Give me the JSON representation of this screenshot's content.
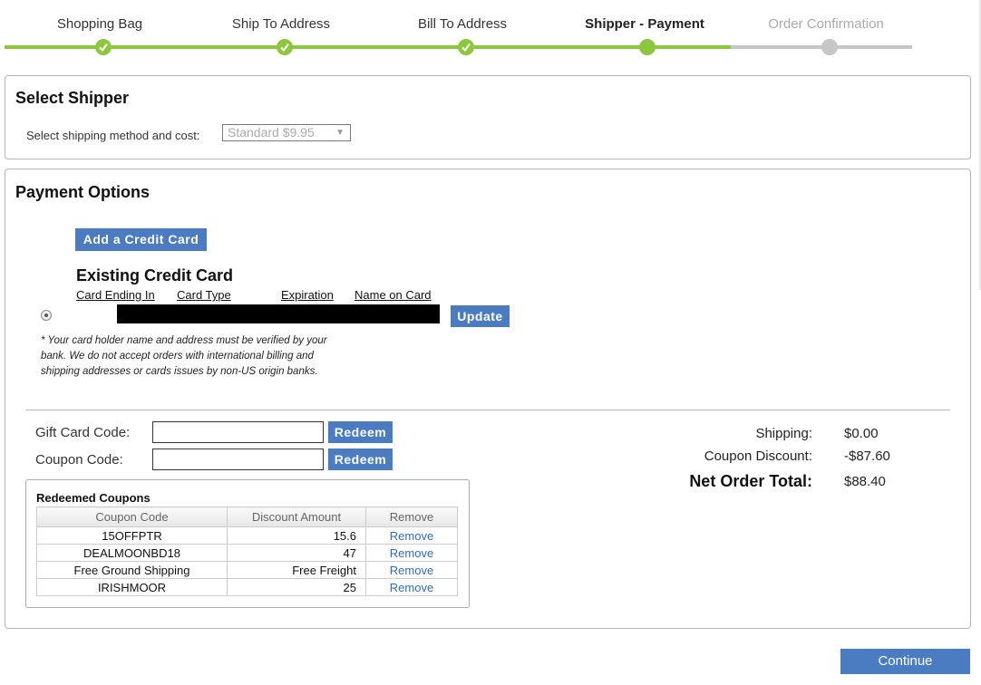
{
  "steps": [
    {
      "label": "Shopping Bag",
      "state": "complete"
    },
    {
      "label": "Ship To Address",
      "state": "complete"
    },
    {
      "label": "Bill To Address",
      "state": "complete"
    },
    {
      "label": "Shipper - Payment",
      "state": "current"
    },
    {
      "label": "Order Confirmation",
      "state": "upcoming"
    }
  ],
  "colors": {
    "accent_green": "#8dc63f",
    "inactive_gray": "#c6c6c6",
    "button_blue": "#4b7cc2",
    "link_blue": "#2f6cc0"
  },
  "shipper": {
    "title": "Select Shipper",
    "method_label": "Select shipping method and cost:",
    "method_value": "Standard $9.95"
  },
  "payment": {
    "title": "Payment Options",
    "add_card_label": "Add a Credit Card",
    "existing_title": "Existing Credit Card",
    "columns": [
      "Card Ending In",
      "Card Type",
      "Expiration",
      "Name on Card"
    ],
    "update_label": "Update",
    "note": "* Your card holder name and address must be verified by your bank. We do not accept orders with international billing and shipping addresses or cards issues by non-US origin banks."
  },
  "codes": {
    "gift_label": "Gift Card Code:",
    "coupon_label": "Coupon Code:",
    "redeem_label": "Redeem"
  },
  "summary": {
    "shipping_label": "Shipping:",
    "shipping_value": "$0.00",
    "discount_label": "Coupon Discount:",
    "discount_value": "-$87.60",
    "total_label": "Net Order Total:",
    "total_value": "$88.40"
  },
  "coupons": {
    "title": "Redeemed Coupons",
    "headers": [
      "Coupon Code",
      "Discount Amount",
      "Remove"
    ],
    "rows": [
      {
        "code": "15OFFPTR",
        "amount": "15.6",
        "action": "Remove"
      },
      {
        "code": "DEALMOONBD18",
        "amount": "47",
        "action": "Remove"
      },
      {
        "code": "Free Ground Shipping",
        "amount": "Free Freight",
        "action": "Remove"
      },
      {
        "code": "IRISHMOOR",
        "amount": "25",
        "action": "Remove"
      }
    ]
  },
  "continue_label": "Continue"
}
